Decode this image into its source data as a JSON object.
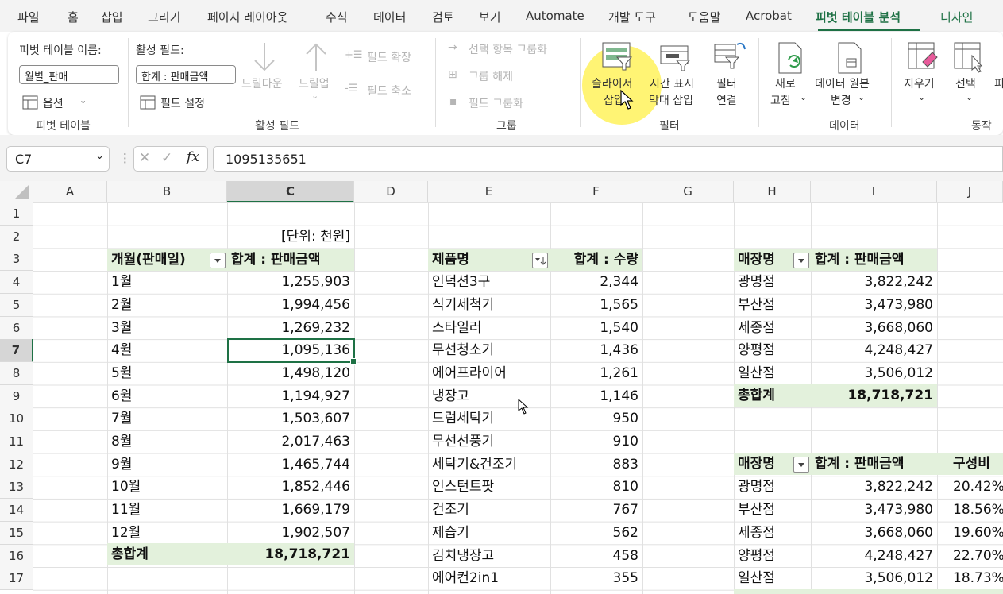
{
  "menu": {
    "file": "파일",
    "home": "홈",
    "insert": "삽입",
    "draw": "그리기",
    "layout": "페이지 레이아웃",
    "formulas": "수식",
    "data": "데이터",
    "review": "검토",
    "view": "보기",
    "automate": "Automate",
    "developer": "개발 도구",
    "help": "도움말",
    "acrobat": "Acrobat",
    "pivot_analyze": "피벗 테이블 분석",
    "design": "디자인"
  },
  "ribbon": {
    "pivot_table": {
      "name_label": "피벗 테이블 이름:",
      "name_value": "월별_판매",
      "options": "옵션",
      "group_label": "피벗 테이블"
    },
    "active_field": {
      "label": "활성 필드:",
      "value": "합계 : 판매금액",
      "settings": "필드 설정",
      "drill_down": "드릴다운",
      "drill_up": "드릴업",
      "expand": "필드 확장",
      "collapse": "필드 축소",
      "group_label": "활성 필드"
    },
    "group": {
      "group_selection": "선택 항목 그룹화",
      "ungroup": "그룹 해제",
      "group_field": "필드 그룹화",
      "group_label": "그룹"
    },
    "filter": {
      "slicer_1": "슬라이서",
      "slicer_2": "삽입",
      "timeline_1": "시간 표시",
      "timeline_2": "막대 삽입",
      "connections_1": "필터",
      "connections_2": "연결",
      "group_label": "필터"
    },
    "data": {
      "refresh_1": "새로",
      "refresh_2": "고침",
      "change_source_1": "데이터 원본",
      "change_source_2": "변경",
      "group_label": "데이터"
    },
    "actions": {
      "clear": "지우기",
      "select": "선택",
      "move": "피",
      "group_label": "동작"
    }
  },
  "formula_bar": {
    "name_box": "C7",
    "formula": "1095135651"
  },
  "columns": [
    "A",
    "B",
    "C",
    "D",
    "E",
    "F",
    "G",
    "H",
    "I",
    "J"
  ],
  "rows": [
    "1",
    "2",
    "3",
    "4",
    "5",
    "6",
    "7",
    "8",
    "9",
    "10",
    "11",
    "12",
    "13",
    "14",
    "15",
    "16",
    "17"
  ],
  "sheet": {
    "unit": "[단위: 천원]",
    "t1": {
      "h1": "개월(판매일)",
      "h2": "합계 : 판매금액",
      "rows": [
        [
          "1월",
          "1,255,903"
        ],
        [
          "2월",
          "1,994,456"
        ],
        [
          "3월",
          "1,269,232"
        ],
        [
          "4월",
          "1,095,136"
        ],
        [
          "5월",
          "1,498,120"
        ],
        [
          "6월",
          "1,194,927"
        ],
        [
          "7월",
          "1,503,607"
        ],
        [
          "8월",
          "2,017,463"
        ],
        [
          "9월",
          "1,465,744"
        ],
        [
          "10월",
          "1,852,446"
        ],
        [
          "11월",
          "1,669,179"
        ],
        [
          "12월",
          "1,902,507"
        ]
      ],
      "total_label": "총합계",
      "total_value": "18,718,721"
    },
    "t2": {
      "h1": "제품명",
      "h2": "합계 : 수량",
      "rows": [
        [
          "인덕션3구",
          "2,344"
        ],
        [
          "식기세척기",
          "1,565"
        ],
        [
          "스타일러",
          "1,540"
        ],
        [
          "무선청소기",
          "1,436"
        ],
        [
          "에어프라이어",
          "1,261"
        ],
        [
          "냉장고",
          "1,146"
        ],
        [
          "드럼세탁기",
          "950"
        ],
        [
          "무선선풍기",
          "910"
        ],
        [
          "세탁기&건조기",
          "883"
        ],
        [
          "인스턴트팟",
          "810"
        ],
        [
          "건조기",
          "767"
        ],
        [
          "제습기",
          "562"
        ],
        [
          "김치냉장고",
          "458"
        ],
        [
          "에어컨2in1",
          "355"
        ]
      ]
    },
    "t3": {
      "h1": "매장명",
      "h2": "합계 : 판매금액",
      "rows": [
        [
          "광명점",
          "3,822,242"
        ],
        [
          "부산점",
          "3,473,980"
        ],
        [
          "세종점",
          "3,668,060"
        ],
        [
          "양평점",
          "4,248,427"
        ],
        [
          "일산점",
          "3,506,012"
        ]
      ],
      "total_label": "총합계",
      "total_value": "18,718,721"
    },
    "t4": {
      "h1": "매장명",
      "h2": "합계 : 판매금액",
      "h3": "구성비",
      "rows": [
        [
          "광명점",
          "3,822,242",
          "20.42%"
        ],
        [
          "부산점",
          "3,473,980",
          "18.56%"
        ],
        [
          "세종점",
          "3,668,060",
          "19.60%"
        ],
        [
          "양평점",
          "4,248,427",
          "22.70%"
        ],
        [
          "일산점",
          "3,506,012",
          "18.73%"
        ]
      ]
    }
  },
  "colors": {
    "accent": "#1e7145",
    "pivot_header": "#e3f1dc",
    "highlight": "#fff046"
  }
}
